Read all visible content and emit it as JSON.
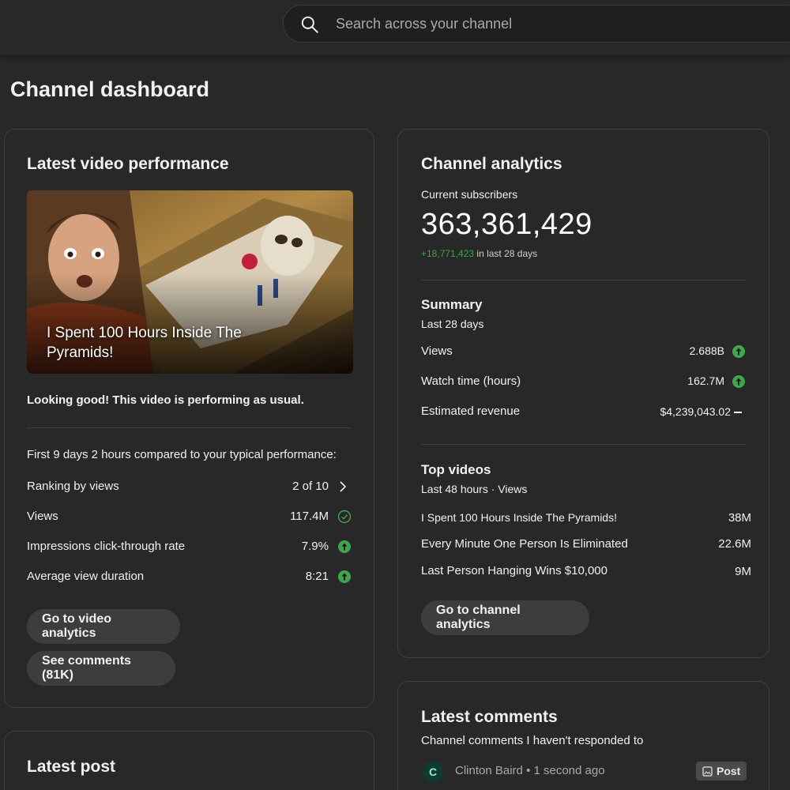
{
  "search": {
    "placeholder": "Search across your channel"
  },
  "page_title": "Channel dashboard",
  "latest_video": {
    "title": "Latest video performance",
    "video_title": "I Spent 100 Hours Inside The Pyramids!",
    "performance_message": "Looking good! This video is performing as usual.",
    "comparison_note": "First 9 days 2 hours compared to your typical performance:",
    "metrics": [
      {
        "label": "Ranking by views",
        "value": "2 of 10",
        "indicator": "chevron-right"
      },
      {
        "label": "Views",
        "value": "117.4M",
        "indicator": "check-circle"
      },
      {
        "label": "Impressions click-through rate",
        "value": "7.9%",
        "indicator": "arrow-up-circle"
      },
      {
        "label": "Average view duration",
        "value": "8:21",
        "indicator": "arrow-up-circle"
      }
    ],
    "buttons": {
      "video_analytics": "Go to video analytics",
      "comments": "See comments (81K)"
    }
  },
  "channel_analytics": {
    "title": "Channel analytics",
    "subscribers_label": "Current subscribers",
    "subscribers": "363,361,429",
    "subscribers_change": "+18,771,423",
    "subscribers_change_period": "in last 28 days",
    "summary": {
      "title": "Summary",
      "period": "Last 28 days",
      "rows": [
        {
          "label": "Views",
          "value": "2.688B",
          "indicator": "arrow-up-circle"
        },
        {
          "label": "Watch time (hours)",
          "value": "162.7M",
          "indicator": "arrow-up-circle"
        },
        {
          "label": "Estimated revenue",
          "value": "$4,239,043.02",
          "indicator": "dash"
        }
      ]
    },
    "top_videos": {
      "title": "Top videos",
      "period": "Last 48 hours · Views",
      "rows": [
        {
          "title": "I Spent 100 Hours Inside The Pyramids!",
          "views": "38M"
        },
        {
          "title": "Every Minute One Person Is Eliminated",
          "views": "22.6M"
        },
        {
          "title": "Last Person Hanging Wins $10,000",
          "views": "9M"
        }
      ]
    },
    "button": "Go to channel analytics"
  },
  "latest_comments": {
    "title": "Latest comments",
    "subtitle": "Channel comments I haven't responded to",
    "comment": {
      "avatar_initial": "C",
      "author": "Clinton Baird",
      "time": "1 second ago",
      "badge": "Post"
    }
  },
  "latest_post": {
    "title": "Latest post"
  },
  "colors": {
    "background": "#282828",
    "card_border": "#3f3f3f",
    "accent_green": "#3ea64b",
    "button_bg": "#3d3d3d"
  }
}
